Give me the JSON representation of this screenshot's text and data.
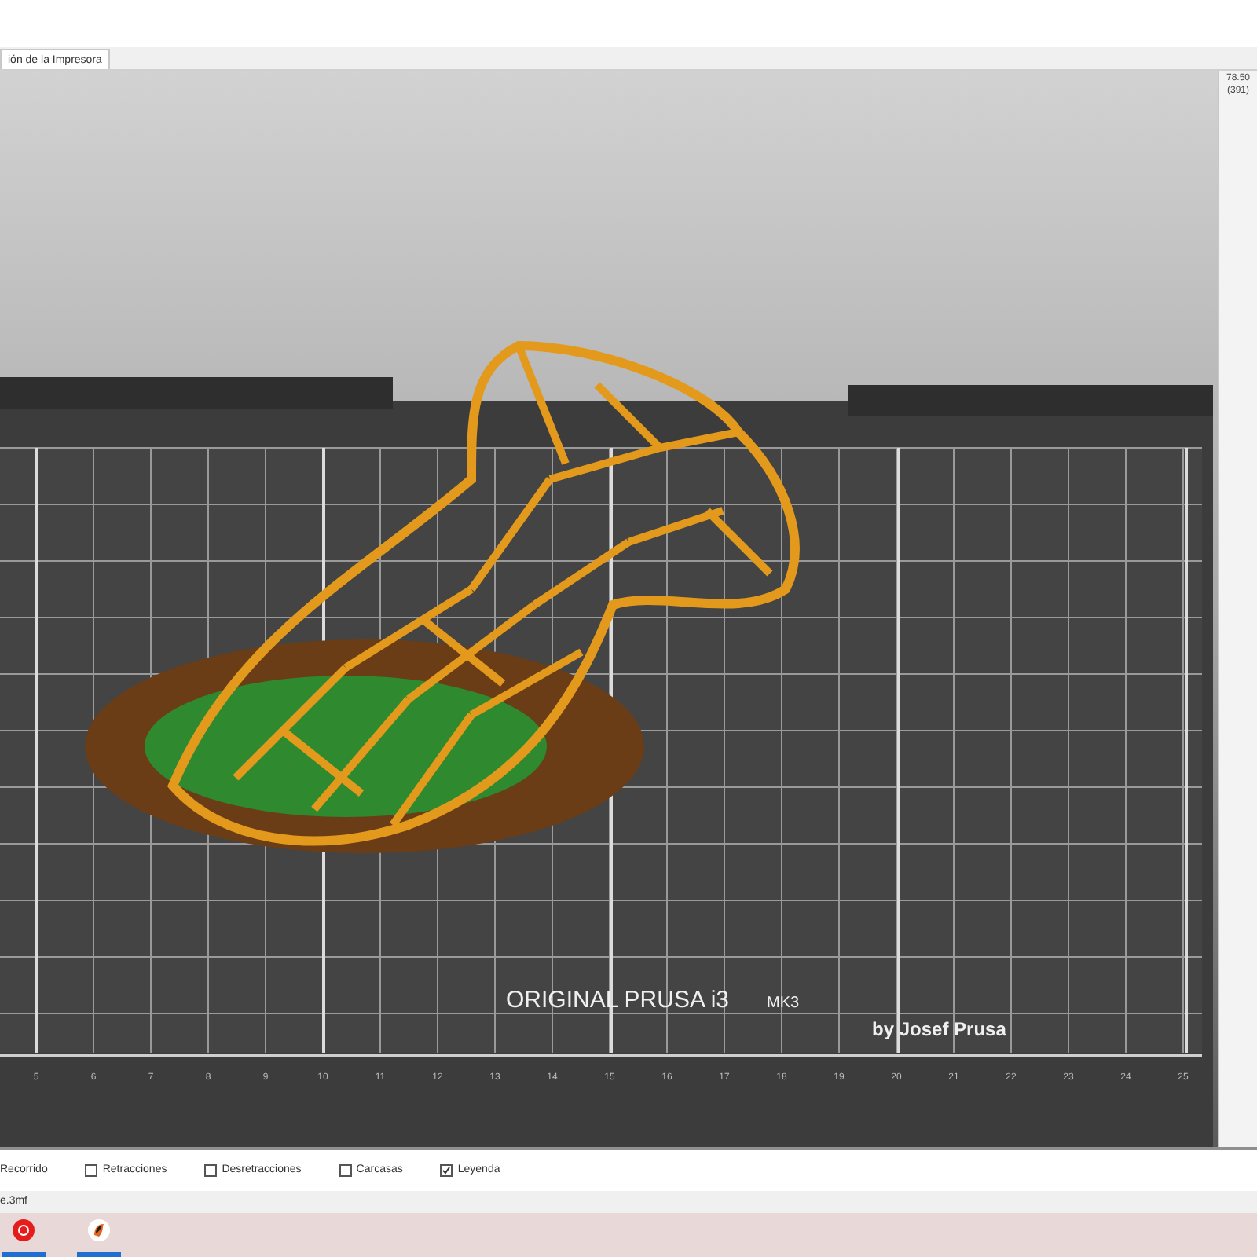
{
  "tabs": [
    {
      "label": "ión de la Impresora",
      "selected": true
    }
  ],
  "layer_slider": {
    "top_value": "78.50",
    "top_layer": "(391)"
  },
  "viewport": {
    "bed_title": "ORIGINAL PRUSA i3",
    "bed_model": "MK3",
    "bed_subtitle": "by Josef Prusa",
    "ruler": [
      "5",
      "6",
      "7",
      "8",
      "9",
      "10",
      "11",
      "12",
      "13",
      "14",
      "15",
      "16",
      "17",
      "18",
      "19",
      "20",
      "21",
      "22",
      "23",
      "24",
      "25"
    ]
  },
  "legend_options": [
    {
      "label": "Recorrido"
    },
    {
      "label": "Retracciones",
      "checked": false
    },
    {
      "label": "Desretracciones",
      "checked": false
    },
    {
      "label": "Carcasas",
      "checked": false
    },
    {
      "label": "Leyenda",
      "checked": true
    }
  ],
  "file_name": "e.3mf",
  "taskbar": {
    "apps": [
      {
        "kind": "record"
      },
      {
        "kind": "slicer"
      }
    ]
  }
}
